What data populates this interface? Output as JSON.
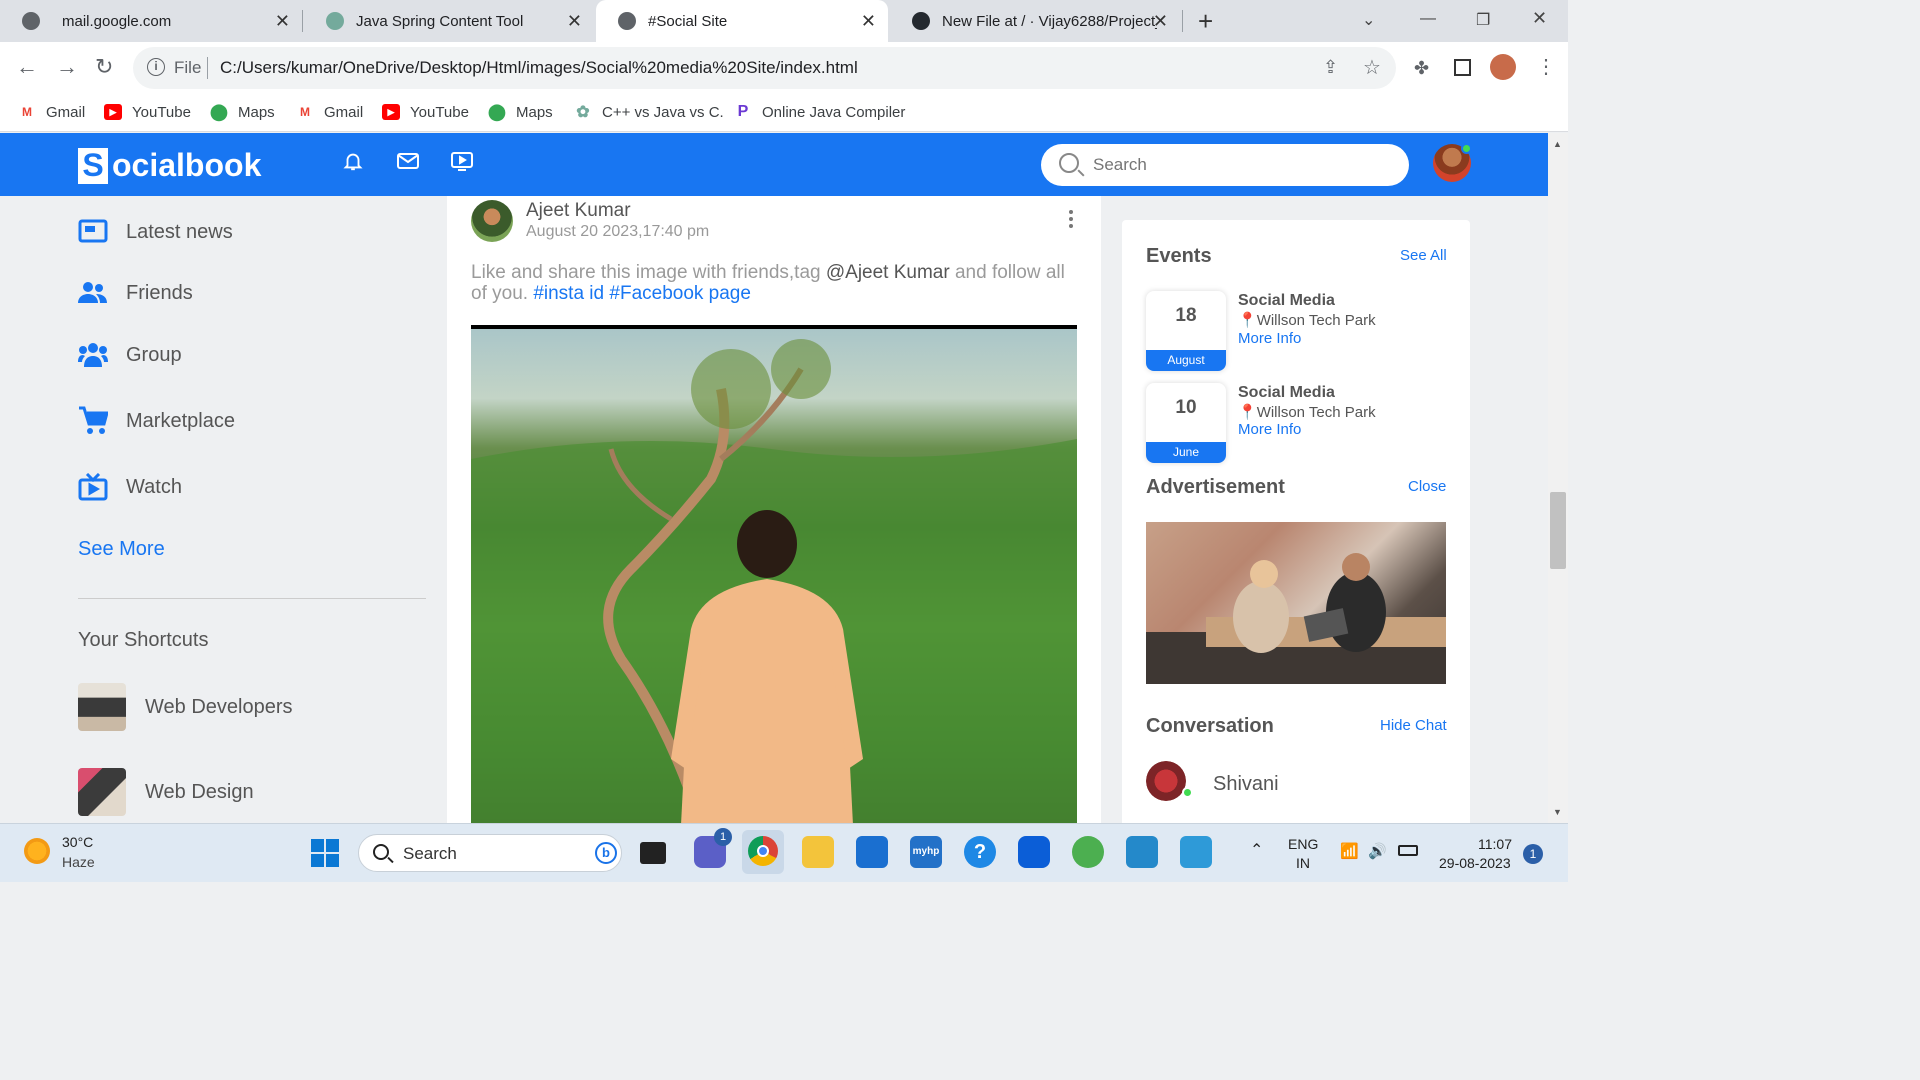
{
  "browser": {
    "tabs": [
      {
        "title": "mail.google.com",
        "icon": "globe-icon"
      },
      {
        "title": "Java Spring Content Tool",
        "icon": "chatgpt-icon"
      },
      {
        "title": "#Social Site",
        "icon": "globe-icon",
        "active": true
      },
      {
        "title": "New File at / · Vijay6288/Project_",
        "icon": "github-icon"
      }
    ],
    "new_tab": "+",
    "close_glyph": "✕",
    "url_scheme": "File",
    "url": "C:/Users/kumar/OneDrive/Desktop/Html/images/Social%20media%20Site/index.html",
    "bookmarks": [
      {
        "label": "Gmail",
        "icon": "gmail-icon"
      },
      {
        "label": "YouTube",
        "icon": "youtube-icon"
      },
      {
        "label": "Maps",
        "icon": "maps-icon"
      },
      {
        "label": "Gmail",
        "icon": "gmail-icon"
      },
      {
        "label": "YouTube",
        "icon": "youtube-icon"
      },
      {
        "label": "Maps",
        "icon": "maps-icon"
      },
      {
        "label": "C++ vs Java vs C.",
        "icon": "chatgpt-icon"
      },
      {
        "label": "Online Java Compiler",
        "icon": "programiz-icon"
      }
    ]
  },
  "site": {
    "logo_letter": "S",
    "logo_text": "ocialbook",
    "search_placeholder": "Search",
    "brand_color": "#1876f2"
  },
  "left_nav": {
    "items": [
      {
        "label": "Latest news",
        "icon": "news-icon"
      },
      {
        "label": "Friends",
        "icon": "friends-icon"
      },
      {
        "label": "Group",
        "icon": "group-icon"
      },
      {
        "label": "Marketplace",
        "icon": "cart-icon"
      },
      {
        "label": "Watch",
        "icon": "watch-icon"
      }
    ],
    "see_more": "See More",
    "shortcuts_title": "Your Shortcuts",
    "shortcuts": [
      {
        "label": "Web Developers"
      },
      {
        "label": "Web Design"
      }
    ]
  },
  "post": {
    "author": "Ajeet Kumar",
    "date": "August 20 2023,17:40 pm",
    "text_pre": "Like and share this image with friends,tag ",
    "mention": "@Ajeet Kumar",
    "text_mid": " and follow all of you. ",
    "hashtag1": "#insta id",
    "hashtag2": "#Facebook page"
  },
  "right": {
    "events_title": "Events",
    "events_see_all": "See All",
    "events": [
      {
        "day": "18",
        "month": "August",
        "title": "Social Media",
        "location": "Willson Tech Park",
        "more": "More Info"
      },
      {
        "day": "10",
        "month": "June",
        "title": "Social Media",
        "location": "Willson Tech Park",
        "more": "More Info"
      }
    ],
    "ad_title": "Advertisement",
    "ad_close": "Close",
    "conv_title": "Conversation",
    "conv_hide": "Hide Chat",
    "contacts": [
      {
        "name": "Shivani",
        "online": true
      }
    ]
  },
  "taskbar": {
    "temp": "30°C",
    "weather": "Haze",
    "search": "Search",
    "teams_badge": "1",
    "lang1": "ENG",
    "lang2": "IN",
    "time": "11:07",
    "date": "29-08-2023",
    "notif": "1"
  }
}
